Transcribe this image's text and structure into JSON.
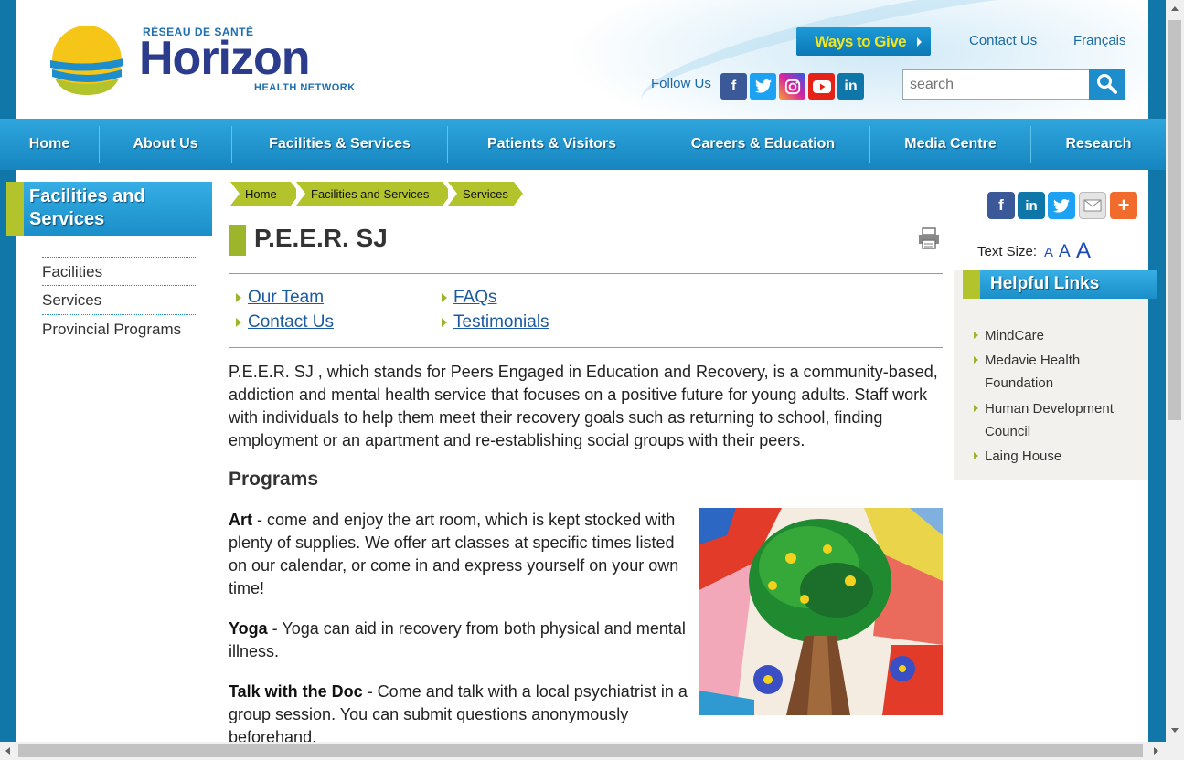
{
  "header": {
    "logo_top": "RÉSEAU DE SANTÉ",
    "logo_main": "Horizon",
    "logo_bottom": "HEALTH NETWORK",
    "ways_to_give": "Ways to Give",
    "contact_us": "Contact Us",
    "francais": "Français",
    "follow_us": "Follow Us",
    "social_icons": [
      "facebook-icon",
      "twitter-icon",
      "instagram-icon",
      "youtube-icon",
      "linkedin-icon"
    ],
    "search_placeholder": "search"
  },
  "nav": {
    "items": [
      "Home",
      "About Us",
      "Facilities & Services",
      "Patients & Visitors",
      "Careers & Education",
      "Media Centre",
      "Research"
    ]
  },
  "left_nav": {
    "heading": "Facilities and Services",
    "items": [
      "Facilities",
      "Services",
      "Provincial Programs"
    ]
  },
  "breadcrumb": [
    "Home",
    "Facilities and Services",
    "Services"
  ],
  "main": {
    "title": "P.E.E.R. SJ",
    "sub_links": [
      "Our Team",
      "Contact Us",
      "FAQs",
      "Testimonials"
    ],
    "intro": "P.E.E.R. SJ , which stands for Peers Engaged in Education and Recovery, is a community-based, addiction and mental health service that focuses on a positive future for young adults. Staff work with individuals to help them meet their recovery goals such as returning to school, finding employment or an apartment and re-establishing social groups with their peers.",
    "programs_heading": "Programs",
    "programs": [
      {
        "name": "Art",
        "text": " - come and enjoy the art room, which is kept stocked with plenty of supplies. We offer art classes at specific times listed on our calendar, or come in and express yourself on your own time!"
      },
      {
        "name": "Yoga",
        "text": " - Yoga can aid in recovery from both physical and mental illness."
      },
      {
        "name": "Talk with the Doc",
        "text": " - Come and talk with a local psychiatrist in a group session. You can submit questions anonymously beforehand."
      }
    ]
  },
  "right": {
    "share_icons": [
      "facebook-icon",
      "linkedin-icon",
      "twitter-icon",
      "email-icon",
      "add-icon"
    ],
    "text_size_label": "Text Size:",
    "text_size_options": [
      "A",
      "A",
      "A"
    ],
    "helpful_heading": "Helpful Links",
    "helpful_links": [
      "MindCare",
      "Medavie Health Foundation",
      "Human Development Council",
      "Laing House"
    ]
  },
  "colors": {
    "nav_blue": "#1d8dcc",
    "accent_green": "#b2c32c",
    "link_blue": "#1b5aa0",
    "ways_yellow": "#f2e51c"
  }
}
